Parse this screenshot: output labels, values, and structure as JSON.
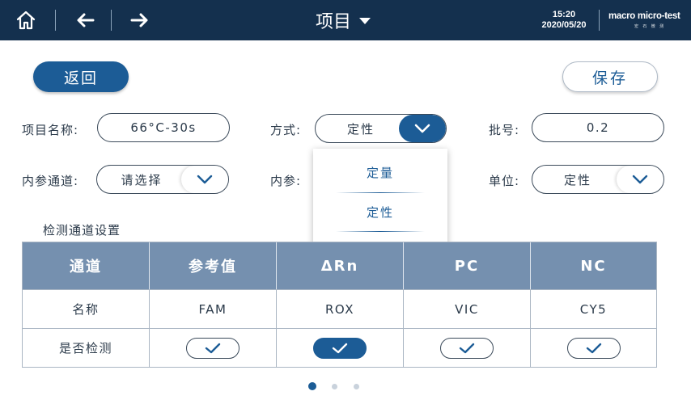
{
  "topbar": {
    "title": "项目",
    "time": "15:20",
    "date": "2020/05/20",
    "logo_text": "macro micro-test",
    "logo_sub": "宏 石 微 测",
    "icons": [
      "home-icon",
      "arrow-left-icon",
      "arrow-right-icon",
      "caret-down-icon"
    ]
  },
  "actions": {
    "back_label": "返回",
    "save_label": "保存"
  },
  "form": {
    "project_name": {
      "label": "项目名称:",
      "value": "66°C-30s"
    },
    "method": {
      "label": "方式:",
      "value": "定性"
    },
    "batch": {
      "label": "批号:",
      "value": "0.2"
    },
    "internal_channel": {
      "label": "内参通道:",
      "value": "请选择"
    },
    "internal_ref": {
      "label": "内参:"
    },
    "unit": {
      "label": "单位:",
      "value": "定性"
    }
  },
  "method_dropdown": {
    "options": [
      "定量",
      "定性"
    ],
    "selected": "定性"
  },
  "channel_settings": {
    "title": "检测通道设置",
    "headers": [
      "通道",
      "参考值",
      "ΔRn",
      "PC",
      "NC"
    ],
    "name_row": {
      "label": "名称",
      "values": [
        "FAM",
        "ROX",
        "VIC",
        "CY5"
      ]
    },
    "detect_row": {
      "label": "是否检测",
      "checked": [
        false,
        true,
        false,
        false
      ]
    }
  },
  "pager": {
    "count": 3,
    "active": 1
  },
  "colors": {
    "topbar": "#14304e",
    "accent": "#1c5c96",
    "table_header": "#7590af"
  }
}
